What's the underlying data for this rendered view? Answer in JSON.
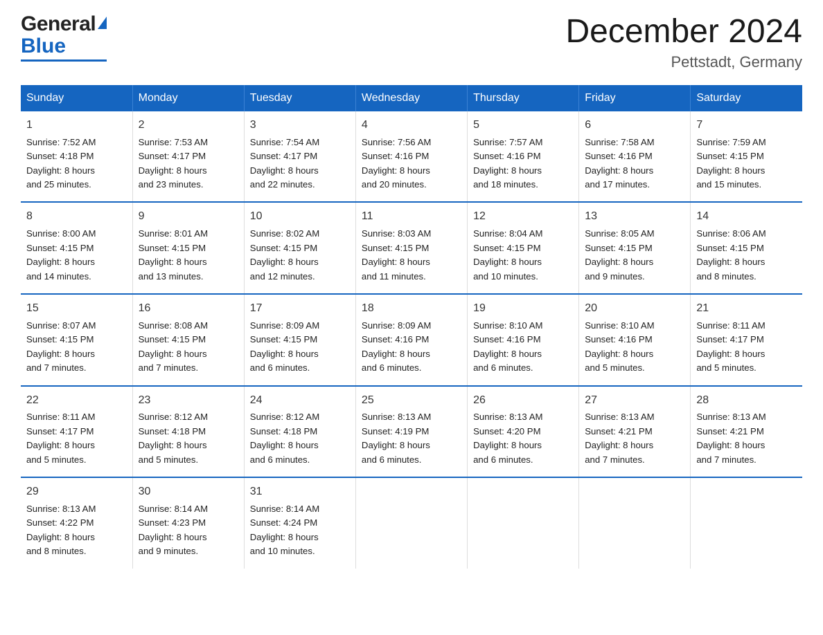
{
  "header": {
    "logo_general": "General",
    "logo_blue": "Blue",
    "main_title": "December 2024",
    "subtitle": "Pettstadt, Germany"
  },
  "columns": [
    "Sunday",
    "Monday",
    "Tuesday",
    "Wednesday",
    "Thursday",
    "Friday",
    "Saturday"
  ],
  "weeks": [
    [
      {
        "day": "1",
        "info": "Sunrise: 7:52 AM\nSunset: 4:18 PM\nDaylight: 8 hours\nand 25 minutes."
      },
      {
        "day": "2",
        "info": "Sunrise: 7:53 AM\nSunset: 4:17 PM\nDaylight: 8 hours\nand 23 minutes."
      },
      {
        "day": "3",
        "info": "Sunrise: 7:54 AM\nSunset: 4:17 PM\nDaylight: 8 hours\nand 22 minutes."
      },
      {
        "day": "4",
        "info": "Sunrise: 7:56 AM\nSunset: 4:16 PM\nDaylight: 8 hours\nand 20 minutes."
      },
      {
        "day": "5",
        "info": "Sunrise: 7:57 AM\nSunset: 4:16 PM\nDaylight: 8 hours\nand 18 minutes."
      },
      {
        "day": "6",
        "info": "Sunrise: 7:58 AM\nSunset: 4:16 PM\nDaylight: 8 hours\nand 17 minutes."
      },
      {
        "day": "7",
        "info": "Sunrise: 7:59 AM\nSunset: 4:15 PM\nDaylight: 8 hours\nand 15 minutes."
      }
    ],
    [
      {
        "day": "8",
        "info": "Sunrise: 8:00 AM\nSunset: 4:15 PM\nDaylight: 8 hours\nand 14 minutes."
      },
      {
        "day": "9",
        "info": "Sunrise: 8:01 AM\nSunset: 4:15 PM\nDaylight: 8 hours\nand 13 minutes."
      },
      {
        "day": "10",
        "info": "Sunrise: 8:02 AM\nSunset: 4:15 PM\nDaylight: 8 hours\nand 12 minutes."
      },
      {
        "day": "11",
        "info": "Sunrise: 8:03 AM\nSunset: 4:15 PM\nDaylight: 8 hours\nand 11 minutes."
      },
      {
        "day": "12",
        "info": "Sunrise: 8:04 AM\nSunset: 4:15 PM\nDaylight: 8 hours\nand 10 minutes."
      },
      {
        "day": "13",
        "info": "Sunrise: 8:05 AM\nSunset: 4:15 PM\nDaylight: 8 hours\nand 9 minutes."
      },
      {
        "day": "14",
        "info": "Sunrise: 8:06 AM\nSunset: 4:15 PM\nDaylight: 8 hours\nand 8 minutes."
      }
    ],
    [
      {
        "day": "15",
        "info": "Sunrise: 8:07 AM\nSunset: 4:15 PM\nDaylight: 8 hours\nand 7 minutes."
      },
      {
        "day": "16",
        "info": "Sunrise: 8:08 AM\nSunset: 4:15 PM\nDaylight: 8 hours\nand 7 minutes."
      },
      {
        "day": "17",
        "info": "Sunrise: 8:09 AM\nSunset: 4:15 PM\nDaylight: 8 hours\nand 6 minutes."
      },
      {
        "day": "18",
        "info": "Sunrise: 8:09 AM\nSunset: 4:16 PM\nDaylight: 8 hours\nand 6 minutes."
      },
      {
        "day": "19",
        "info": "Sunrise: 8:10 AM\nSunset: 4:16 PM\nDaylight: 8 hours\nand 6 minutes."
      },
      {
        "day": "20",
        "info": "Sunrise: 8:10 AM\nSunset: 4:16 PM\nDaylight: 8 hours\nand 5 minutes."
      },
      {
        "day": "21",
        "info": "Sunrise: 8:11 AM\nSunset: 4:17 PM\nDaylight: 8 hours\nand 5 minutes."
      }
    ],
    [
      {
        "day": "22",
        "info": "Sunrise: 8:11 AM\nSunset: 4:17 PM\nDaylight: 8 hours\nand 5 minutes."
      },
      {
        "day": "23",
        "info": "Sunrise: 8:12 AM\nSunset: 4:18 PM\nDaylight: 8 hours\nand 5 minutes."
      },
      {
        "day": "24",
        "info": "Sunrise: 8:12 AM\nSunset: 4:18 PM\nDaylight: 8 hours\nand 6 minutes."
      },
      {
        "day": "25",
        "info": "Sunrise: 8:13 AM\nSunset: 4:19 PM\nDaylight: 8 hours\nand 6 minutes."
      },
      {
        "day": "26",
        "info": "Sunrise: 8:13 AM\nSunset: 4:20 PM\nDaylight: 8 hours\nand 6 minutes."
      },
      {
        "day": "27",
        "info": "Sunrise: 8:13 AM\nSunset: 4:21 PM\nDaylight: 8 hours\nand 7 minutes."
      },
      {
        "day": "28",
        "info": "Sunrise: 8:13 AM\nSunset: 4:21 PM\nDaylight: 8 hours\nand 7 minutes."
      }
    ],
    [
      {
        "day": "29",
        "info": "Sunrise: 8:13 AM\nSunset: 4:22 PM\nDaylight: 8 hours\nand 8 minutes."
      },
      {
        "day": "30",
        "info": "Sunrise: 8:14 AM\nSunset: 4:23 PM\nDaylight: 8 hours\nand 9 minutes."
      },
      {
        "day": "31",
        "info": "Sunrise: 8:14 AM\nSunset: 4:24 PM\nDaylight: 8 hours\nand 10 minutes."
      },
      {
        "day": "",
        "info": ""
      },
      {
        "day": "",
        "info": ""
      },
      {
        "day": "",
        "info": ""
      },
      {
        "day": "",
        "info": ""
      }
    ]
  ]
}
